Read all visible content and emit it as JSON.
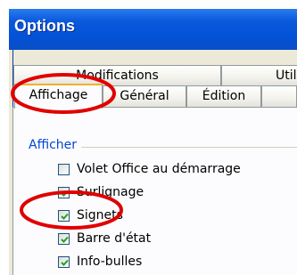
{
  "window": {
    "title": "Options"
  },
  "tabs": {
    "back_row": [
      "Modifications",
      "Utilis"
    ],
    "front_row": [
      "Affichage",
      "Général",
      "Édition"
    ],
    "active": "Affichage"
  },
  "group": {
    "title": "Afficher"
  },
  "options": [
    {
      "label": "Volet Office au démarrage",
      "checked": false
    },
    {
      "label": "Surlignage",
      "checked": true
    },
    {
      "label": "Signets",
      "checked": true
    },
    {
      "label": "Barre d'état",
      "checked": true
    },
    {
      "label": "Info-bulles",
      "checked": true
    }
  ],
  "colors": {
    "titlebar": "#0352d6",
    "group_title": "#0046d5",
    "annotation": "#e00000",
    "check": "#21a121"
  }
}
